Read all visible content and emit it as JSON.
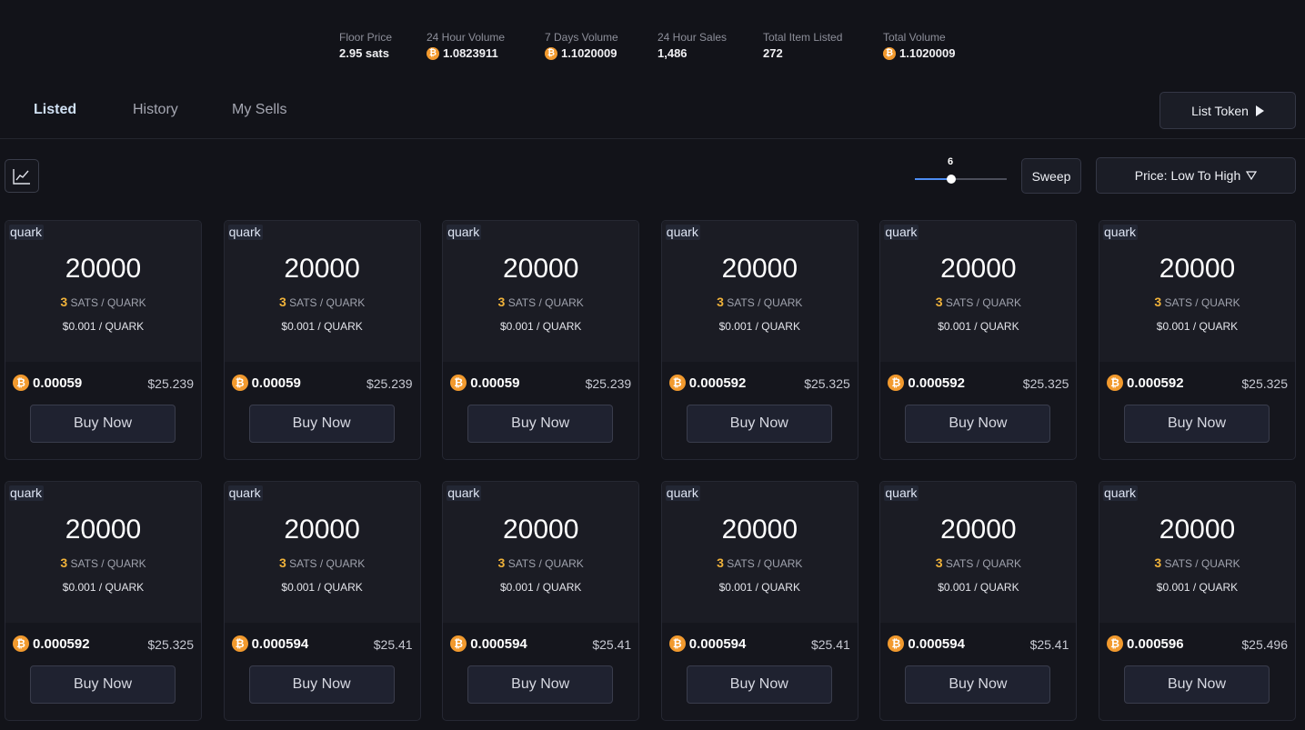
{
  "stats": [
    {
      "label": "Floor Price",
      "value": "2.95 sats",
      "btc": false
    },
    {
      "label": "24 Hour Volume",
      "value": "1.0823911",
      "btc": true
    },
    {
      "label": "7 Days Volume",
      "value": "1.1020009",
      "btc": true
    },
    {
      "label": "24 Hour Sales",
      "value": "1,486",
      "btc": false
    },
    {
      "label": "Total Item Listed",
      "value": "272",
      "btc": false
    },
    {
      "label": "Total Volume",
      "value": "1.1020009",
      "btc": true
    }
  ],
  "tabs": [
    {
      "label": "Listed",
      "active": true
    },
    {
      "label": "History",
      "active": false
    },
    {
      "label": "My Sells",
      "active": false
    }
  ],
  "list_token_label": "List Token",
  "slider": {
    "value": "6",
    "fraction": 0.4
  },
  "sweep_label": "Sweep",
  "sort_label": "Price: Low To High",
  "btc_symbol": "₿",
  "cards": [
    {
      "tag": "quark",
      "amount": "20000",
      "sats": "3",
      "sats_unit": "SATS / QUARK",
      "usd": "$0.001 / QUARK",
      "btc": "0.00059",
      "price": "$25.239",
      "buy_label": "Buy Now"
    },
    {
      "tag": "quark",
      "amount": "20000",
      "sats": "3",
      "sats_unit": "SATS / QUARK",
      "usd": "$0.001 / QUARK",
      "btc": "0.00059",
      "price": "$25.239",
      "buy_label": "Buy Now"
    },
    {
      "tag": "quark",
      "amount": "20000",
      "sats": "3",
      "sats_unit": "SATS / QUARK",
      "usd": "$0.001 / QUARK",
      "btc": "0.00059",
      "price": "$25.239",
      "buy_label": "Buy Now"
    },
    {
      "tag": "quark",
      "amount": "20000",
      "sats": "3",
      "sats_unit": "SATS / QUARK",
      "usd": "$0.001 / QUARK",
      "btc": "0.000592",
      "price": "$25.325",
      "buy_label": "Buy Now"
    },
    {
      "tag": "quark",
      "amount": "20000",
      "sats": "3",
      "sats_unit": "SATS / QUARK",
      "usd": "$0.001 / QUARK",
      "btc": "0.000592",
      "price": "$25.325",
      "buy_label": "Buy Now"
    },
    {
      "tag": "quark",
      "amount": "20000",
      "sats": "3",
      "sats_unit": "SATS / QUARK",
      "usd": "$0.001 / QUARK",
      "btc": "0.000592",
      "price": "$25.325",
      "buy_label": "Buy Now"
    },
    {
      "tag": "quark",
      "amount": "20000",
      "sats": "3",
      "sats_unit": "SATS / QUARK",
      "usd": "$0.001 / QUARK",
      "btc": "0.000592",
      "price": "$25.325",
      "buy_label": "Buy Now"
    },
    {
      "tag": "quark",
      "amount": "20000",
      "sats": "3",
      "sats_unit": "SATS / QUARK",
      "usd": "$0.001 / QUARK",
      "btc": "0.000594",
      "price": "$25.41",
      "buy_label": "Buy Now"
    },
    {
      "tag": "quark",
      "amount": "20000",
      "sats": "3",
      "sats_unit": "SATS / QUARK",
      "usd": "$0.001 / QUARK",
      "btc": "0.000594",
      "price": "$25.41",
      "buy_label": "Buy Now"
    },
    {
      "tag": "quark",
      "amount": "20000",
      "sats": "3",
      "sats_unit": "SATS / QUARK",
      "usd": "$0.001 / QUARK",
      "btc": "0.000594",
      "price": "$25.41",
      "buy_label": "Buy Now"
    },
    {
      "tag": "quark",
      "amount": "20000",
      "sats": "3",
      "sats_unit": "SATS / QUARK",
      "usd": "$0.001 / QUARK",
      "btc": "0.000594",
      "price": "$25.41",
      "buy_label": "Buy Now"
    },
    {
      "tag": "quark",
      "amount": "20000",
      "sats": "3",
      "sats_unit": "SATS / QUARK",
      "usd": "$0.001 / QUARK",
      "btc": "0.000596",
      "price": "$25.496",
      "buy_label": "Buy Now"
    }
  ],
  "colors": {
    "background": "#121319",
    "btc": "#f29a2e",
    "sats": "#f0b23a",
    "slider": "#4d8df2"
  }
}
